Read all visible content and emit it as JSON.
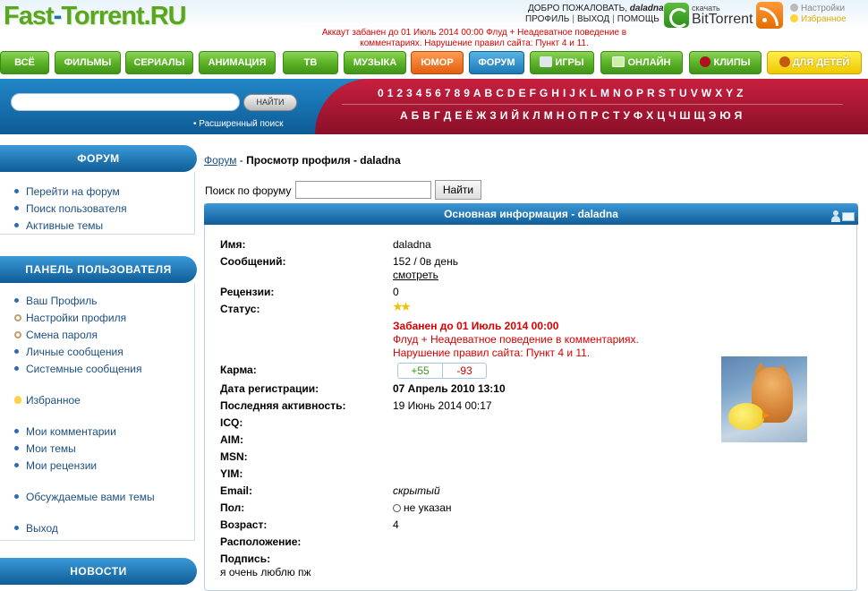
{
  "header": {
    "logo_part1": "Fast",
    "logo_dash": "-",
    "logo_part2": "Torrent.RU",
    "welcome_prefix": "ДОБРО ПОЖАЛОВАТЬ,",
    "username": "daladna",
    "profile_link": "ПРОФИЛЬ",
    "logout_link": "ВЫХОД",
    "help_link": "ПОМОЩЬ",
    "bittorrent_small": "скачать",
    "bittorrent_name": "BitTorrent",
    "settings_link": "Настройки",
    "favorites_link": "Избранное",
    "ban_notice": "Аккаут забанен до 01 Июль 2014 00:00 Флуд + Неадеватное поведение в комментариях. Нарушение правил сайта: Пункт 4 и 11."
  },
  "nav": {
    "items": [
      "ВСЁ",
      "ФИЛЬМЫ",
      "СЕРИАЛЫ",
      "АНИМАЦИЯ",
      "ТВ",
      "МУЗЫКА",
      "ЮМОР",
      "ФОРУМ",
      "ИГРЫ",
      "ОНЛАЙН",
      "КЛИПЫ",
      "ДЛЯ ДЕТЕЙ"
    ]
  },
  "search": {
    "button_label": "НАЙТИ",
    "advanced_label": "• Расширенный поиск",
    "latin": [
      "0",
      "1",
      "2",
      "3",
      "4",
      "5",
      "6",
      "7",
      "8",
      "9",
      "A",
      "B",
      "C",
      "D",
      "E",
      "F",
      "G",
      "H",
      "I",
      "J",
      "K",
      "L",
      "M",
      "N",
      "O",
      "P",
      "R",
      "S",
      "T",
      "U",
      "V",
      "W",
      "X",
      "Y",
      "Z"
    ],
    "cyrillic": [
      "А",
      "Б",
      "В",
      "Г",
      "Д",
      "Е",
      "Ё",
      "Ж",
      "З",
      "И",
      "Й",
      "К",
      "Л",
      "М",
      "Н",
      "О",
      "П",
      "Р",
      "С",
      "Т",
      "У",
      "Ф",
      "Х",
      "Ц",
      "Ч",
      "Ш",
      "Щ",
      "Э",
      "Ю",
      "Я"
    ]
  },
  "sidebar": {
    "forum_head": "ФОРУМ",
    "forum_items": [
      "Перейти на форум",
      "Поиск пользователя",
      "Активные темы"
    ],
    "panel_head": "ПАНЕЛЬ ПОЛЬЗОВАТЕЛЯ",
    "panel_items": [
      "Ваш Профиль",
      "Настройки профиля",
      "Смена пароля",
      "Личные сообщения",
      "Системные сообщения",
      "Избранное",
      "Мои комментарии",
      "Мои темы",
      "Мои рецензии",
      "Обсуждаемые вами темы",
      "Выход"
    ],
    "news_head": "НОВОСТИ"
  },
  "main": {
    "breadcrumb_link": "Форум",
    "breadcrumb_sep": " - ",
    "breadcrumb_title": "Просмотр профиля - daladna",
    "forum_search_label": "Поиск по форуму",
    "forum_search_button": "Найти",
    "panel_title": "Основная информация - daladna"
  },
  "profile": {
    "name_label": "Имя:",
    "name_value": "daladna",
    "posts_label": "Сообщений:",
    "posts_value": "152 / 0в день",
    "posts_link": "смотреть",
    "reviews_label": "Рецензии:",
    "reviews_value": "0",
    "status_label": "Статус:",
    "ban_title": "Забанен до 01 Июль 2014 00:00",
    "ban_reason1": "Флуд + Неадеватное поведение в комментариях.",
    "ban_reason2": "Нарушение правил сайта: Пункт 4 и 11.",
    "karma_label": "Карма:",
    "karma_plus": "+55",
    "karma_minus": "-93",
    "reg_label": "Дата регистрации:",
    "reg_value": "07 Апрель 2010 13:10",
    "activity_label": "Последняя активность:",
    "activity_value": "19 Июнь 2014 00:17",
    "icq_label": "ICQ:",
    "aim_label": "AIM:",
    "msn_label": "MSN:",
    "yim_label": "YIM:",
    "email_label": "Email:",
    "email_value": "скрытый",
    "gender_label": "Пол:",
    "gender_value": "не указан",
    "age_label": "Возраст:",
    "age_value": "4",
    "location_label": "Расположение:",
    "signature_label": "Подпись:",
    "signature_value": "я очень люблю пж"
  }
}
